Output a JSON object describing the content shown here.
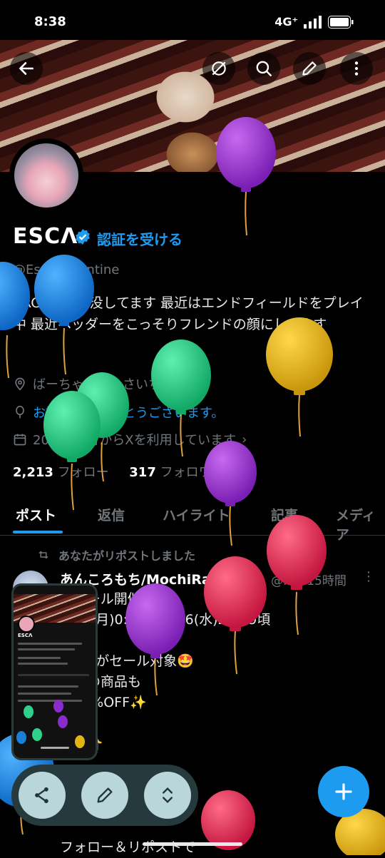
{
  "status_bar": {
    "time": "8:38",
    "network": "4G⁺"
  },
  "colors": {
    "accent": "#1d9bf0",
    "background": "#000000"
  },
  "top_actions": [
    "back-icon",
    "translate-off-icon",
    "search-icon",
    "edit-icon",
    "more-icon"
  ],
  "profile": {
    "name": "ESCΛ",
    "verify_link": "認証を受ける",
    "handle": "@Esca Valentine",
    "bio": "VRChatに出没してます 最近はエンドフィールドをプレイ中 最近ヘッダーをこっそりフレンドの顔にしてます",
    "location": "ばーちゃるかんさいちほー",
    "birthday": "お誕生日おめでとうございます。",
    "joined": "2015年8月からXを利用しています",
    "following_count": "2,213",
    "following_label": "フォロー",
    "followers_count": "317",
    "followers_label": "フォロワー"
  },
  "tabs": [
    {
      "label": "ポスト",
      "active": true
    },
    {
      "label": "返信",
      "active": false
    },
    {
      "label": "ハイライト",
      "active": false
    },
    {
      "label": "記事",
      "active": false
    },
    {
      "label": "メディア",
      "active": false
    }
  ],
  "post": {
    "repost_note": "あなたがリポストしました",
    "author": "あんころもち/MochiRabbit",
    "meta": "@...・15時間",
    "text": "Wセール開催🔥\n4/27(月)0:00頃〜5/6(水)23:59頃\n\n5商品がセール対象🤩\nのあの商品も\nら20%OFF✨\n\nらに👇\n\nャンペーン開催🎁\n】\n\nフォロー＆リポストで"
  },
  "pip": {
    "name": "ESCΛ"
  }
}
